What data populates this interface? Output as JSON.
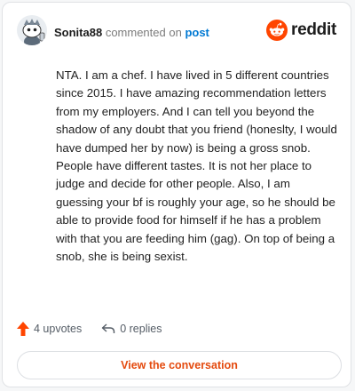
{
  "header": {
    "username": "Sonita88",
    "action_text": "commented on",
    "post_link": "post",
    "brand_name": "reddit",
    "brand_color": "#ff4500",
    "avatar_icon": "snoo-avatar-icon"
  },
  "comment": {
    "text": "NTA. I am a chef. I have lived in 5 different countries since 2015. I have amazing recommendation letters from my employers. And I can tell you beyond the shadow of any doubt that you friend (honeslty, I would have dumped her by now) is being a gross snob. People have different tastes. It is not her place to judge and decide for other people. Also, I am guessing your bf is roughly your age, so he should be able to provide food for himself if he has a problem with that you are feeding him (gag). On top of being a snob, she is being sexist."
  },
  "footer": {
    "upvotes": "4 upvotes",
    "replies": "0 replies",
    "upvote_icon": "upvote-arrow-icon",
    "reply_icon": "reply-arrow-icon",
    "upvote_color": "#ff4500"
  },
  "cta": {
    "label": "View the conversation",
    "color": "#e44a0e"
  }
}
